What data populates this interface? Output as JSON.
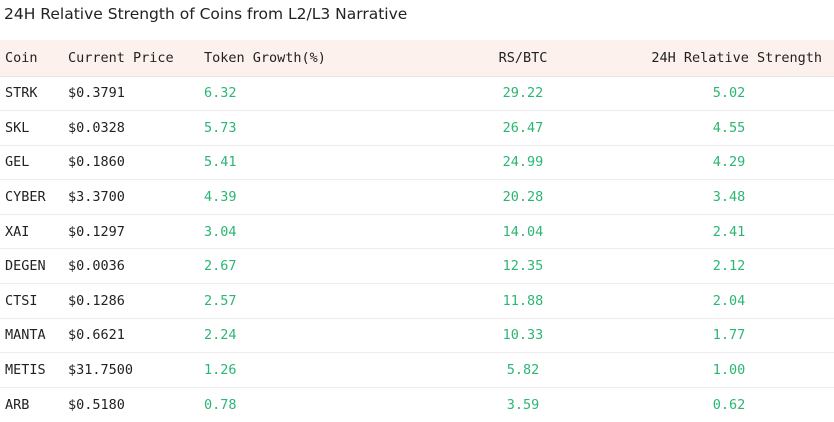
{
  "title": "24H Relative Strength of Coins from L2/L3 Narrative",
  "colors": {
    "header_bg": "#fdf1ee",
    "positive": "#2bb673",
    "text": "#222222"
  },
  "table": {
    "headers": [
      "Coin",
      "Current Price",
      "Token Growth(%)",
      "RS/BTC",
      "24H Relative Strength"
    ],
    "rows": [
      [
        "STRK",
        "$0.3791",
        "6.32",
        "29.22",
        "5.02"
      ],
      [
        "SKL",
        "$0.0328",
        "5.73",
        "26.47",
        "4.55"
      ],
      [
        "GEL",
        "$0.1860",
        "5.41",
        "24.99",
        "4.29"
      ],
      [
        "CYBER",
        "$3.3700",
        "4.39",
        "20.28",
        "3.48"
      ],
      [
        "XAI",
        "$0.1297",
        "3.04",
        "14.04",
        "2.41"
      ],
      [
        "DEGEN",
        "$0.0036",
        "2.67",
        "12.35",
        "2.12"
      ],
      [
        "CTSI",
        "$0.1286",
        "2.57",
        "11.88",
        "2.04"
      ],
      [
        "MANTA",
        "$0.6621",
        "2.24",
        "10.33",
        "1.77"
      ],
      [
        "METIS",
        "$31.7500",
        "1.26",
        "5.82",
        "1.00"
      ],
      [
        "ARB",
        "$0.5180",
        "0.78",
        "3.59",
        "0.62"
      ]
    ]
  }
}
